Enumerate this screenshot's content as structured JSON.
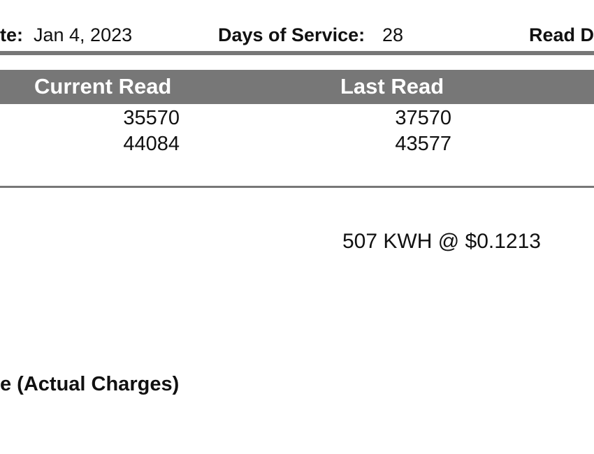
{
  "info_row": {
    "read_date_label_partial": "te:",
    "read_date_value": "Jan 4, 2023",
    "days_label": "Days of Service:",
    "days_value": "28",
    "next_label_partial": "Read D"
  },
  "meter_table": {
    "columns": [
      "Current Read",
      "Last Read"
    ],
    "rows": [
      {
        "current": "35570",
        "last": "37570"
      },
      {
        "current": "44084",
        "last": "43577"
      }
    ]
  },
  "usage": {
    "line": "507 KWH @ $0.1213"
  },
  "section": {
    "title_partial": "e (Actual Charges)"
  },
  "colors": {
    "header_bar": "#777777",
    "rule": "#777777",
    "header_text": "#ffffff"
  }
}
